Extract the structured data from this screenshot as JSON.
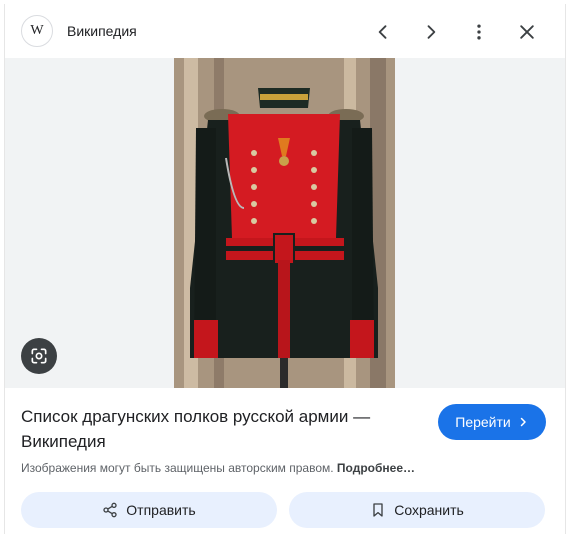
{
  "header": {
    "logo_letter": "W",
    "site_name": "Википедия",
    "icons": [
      "chevron-left-icon",
      "chevron-right-icon",
      "more-vert-icon",
      "close-icon"
    ]
  },
  "image": {
    "subject": "uniform-photo",
    "lens_icon": "lens-search-icon"
  },
  "result": {
    "title": "Список драгунских полков русской армии — Википедия",
    "goto_label": "Перейти",
    "notice_text": "Изображения могут быть защищены авторским правом. ",
    "notice_more": "Подробнее…"
  },
  "actions": {
    "share_label": "Отправить",
    "save_label": "Сохранить"
  },
  "colors": {
    "accent": "#1a73e8",
    "action_bg": "#e8f0fe",
    "image_bg": "#f1f3f4"
  }
}
